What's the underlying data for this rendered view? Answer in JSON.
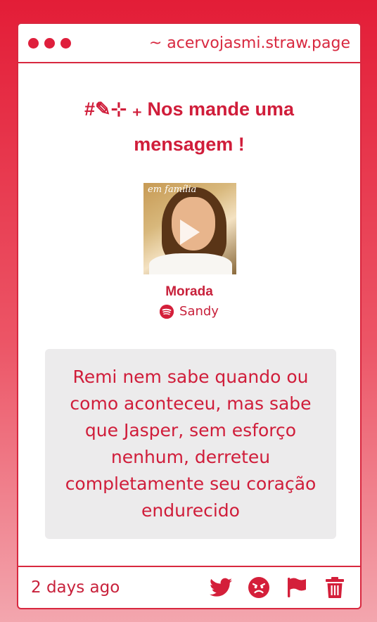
{
  "browser": {
    "url": "~ acervojasmi.straw.page"
  },
  "post": {
    "heading": "#✎⊹ ₊ Nos mande uma mensagem !",
    "song": {
      "title": "Morada",
      "artist": "Sandy",
      "cover_text": "em família"
    },
    "message": "Remi nem sabe quando ou como aconteceu, mas sabe que Jasper, sem esforço nenhum, derreteu completamente seu coração endurecido",
    "time": "2 days ago"
  },
  "icons": [
    "twitter-icon",
    "angry-face-icon",
    "flag-icon",
    "trash-icon",
    "spotify-icon",
    "play-icon"
  ],
  "colors": {
    "accent": "#d8283f",
    "background_top": "#e31d37",
    "background_bottom": "#f3a6ae",
    "message_bg": "#ecebec"
  }
}
